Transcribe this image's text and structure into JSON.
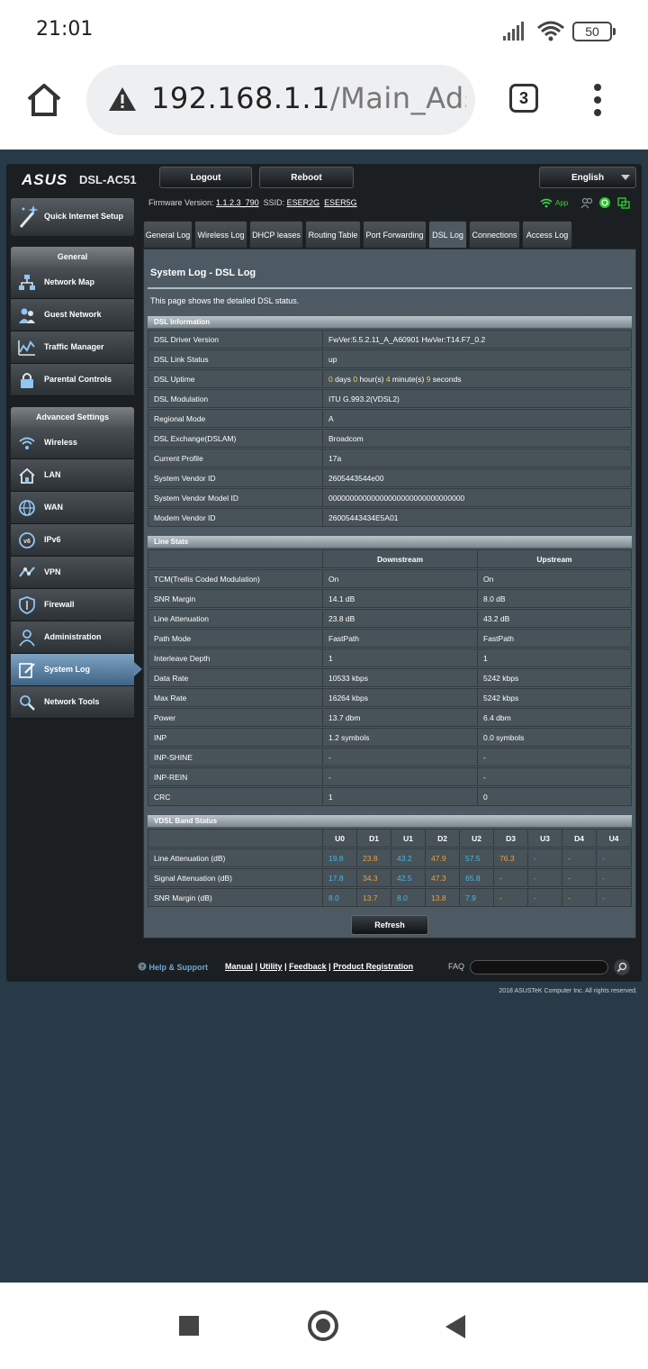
{
  "status_bar": {
    "time": "21:01",
    "battery": "50"
  },
  "browser": {
    "url_host": "192.168.1.1",
    "url_path": "/Main_AdslS",
    "tab_count": "3"
  },
  "router": {
    "brand": "ASUS",
    "model": "DSL-AC51",
    "logout_label": "Logout",
    "reboot_label": "Reboot",
    "language": "English",
    "firmware_label": "Firmware Version:",
    "firmware_value": "1.1.2.3_790",
    "ssid_label": "SSID:",
    "ssid_2g": "ESER2G",
    "ssid_5g": "ESER5G",
    "app_label": "App"
  },
  "sidebar": {
    "quick_setup": "Quick Internet Setup",
    "general_header": "General",
    "general_items": [
      "Network Map",
      "Guest Network",
      "Traffic Manager",
      "Parental Controls"
    ],
    "advanced_header": "Advanced Settings",
    "advanced_items": [
      "Wireless",
      "LAN",
      "WAN",
      "IPv6",
      "VPN",
      "Firewall",
      "Administration",
      "System Log",
      "Network Tools"
    ]
  },
  "tabs": [
    "General Log",
    "Wireless Log",
    "DHCP leases",
    "Routing Table",
    "Port Forwarding",
    "DSL Log",
    "Connections",
    "Access Log"
  ],
  "content": {
    "title": "System Log - DSL Log",
    "description": "This page shows the detailed DSL status.",
    "dsl_info_header": "DSL Information",
    "dsl_info": [
      {
        "label": "DSL Driver Version",
        "value": "FwVer:5.5.2.11_A_A60901 HwVer:T14.F7_0.2"
      },
      {
        "label": "DSL Link Status",
        "value": "up"
      },
      {
        "label": "DSL Uptime",
        "value": ""
      },
      {
        "label": "DSL Modulation",
        "value": "ITU G.993.2(VDSL2)"
      },
      {
        "label": "Regional Mode",
        "value": "A"
      },
      {
        "label": "DSL Exchange(DSLAM)",
        "value": "Broadcom"
      },
      {
        "label": "Current Profile",
        "value": "17a"
      },
      {
        "label": "System Vendor ID",
        "value": "2605443544e00"
      },
      {
        "label": "System Vendor Model ID",
        "value": "00000000000000000000000000000000"
      },
      {
        "label": "Modem Vendor ID",
        "value": "26005443434E5A01"
      }
    ],
    "uptime": {
      "days": "0",
      "days_label": " days ",
      "hours": "0",
      "hours_label": " hour(s) ",
      "minutes": "4",
      "minutes_label": " minute(s) ",
      "seconds": "9",
      "seconds_label": " seconds"
    },
    "line_stats_header": "Line Stats",
    "line_stats_columns": [
      "Downstream",
      "Upstream"
    ],
    "line_stats": [
      {
        "label": "TCM(Trellis Coded Modulation)",
        "down": "On",
        "up": "On"
      },
      {
        "label": "SNR Margin",
        "down": "14.1 dB",
        "up": "8.0 dB"
      },
      {
        "label": "Line Attenuation",
        "down": "23.8 dB",
        "up": "43.2 dB"
      },
      {
        "label": "Path Mode",
        "down": "FastPath",
        "up": "FastPath"
      },
      {
        "label": "Interleave Depth",
        "down": "1",
        "up": "1"
      },
      {
        "label": "Data Rate",
        "down": "10533 kbps",
        "up": "5242 kbps"
      },
      {
        "label": "Max Rate",
        "down": "16264 kbps",
        "up": "5242 kbps"
      },
      {
        "label": "Power",
        "down": "13.7 dbm",
        "up": "6.4 dbm"
      },
      {
        "label": "INP",
        "down": "1.2 symbols",
        "up": "0.0 symbols"
      },
      {
        "label": "INP-SHINE",
        "down": "-",
        "up": "-"
      },
      {
        "label": "INP-REIN",
        "down": "-",
        "up": "-"
      },
      {
        "label": "CRC",
        "down": "1",
        "up": "0"
      }
    ],
    "vdsl_header": "VDSL Band Status",
    "vdsl_columns": [
      "U0",
      "D1",
      "U1",
      "D2",
      "U2",
      "D3",
      "U3",
      "D4",
      "U4"
    ],
    "vdsl_rows": [
      {
        "label": "Line Attenuation (dB)",
        "values": [
          "19.8",
          "23.8",
          "43.2",
          "47.9",
          "57.5",
          "76.3",
          "-",
          "-",
          "-"
        ]
      },
      {
        "label": "Signal Attenuation (dB)",
        "values": [
          "17.8",
          "34.3",
          "42.5",
          "47.3",
          "65.8",
          "-",
          "-",
          "-",
          "-"
        ]
      },
      {
        "label": "SNR Margin (dB)",
        "values": [
          "8.0",
          "13.7",
          "8.0",
          "13.8",
          "7.9",
          "-",
          "-",
          "-",
          "-"
        ]
      }
    ],
    "refresh_label": "Refresh"
  },
  "footer": {
    "help": "Help & Support",
    "links": [
      "Manual",
      "Utility",
      "Feedback",
      "Product Registration"
    ],
    "faq": "FAQ",
    "copyright": "2018 ASUSTeK Computer Inc. All rights reserved."
  },
  "colors": {
    "upstream_value": "#4cb6e8",
    "downstream_value": "#f0a23a",
    "uptime_number": "#f4d24b",
    "selected_menu": "#5d86aa"
  }
}
